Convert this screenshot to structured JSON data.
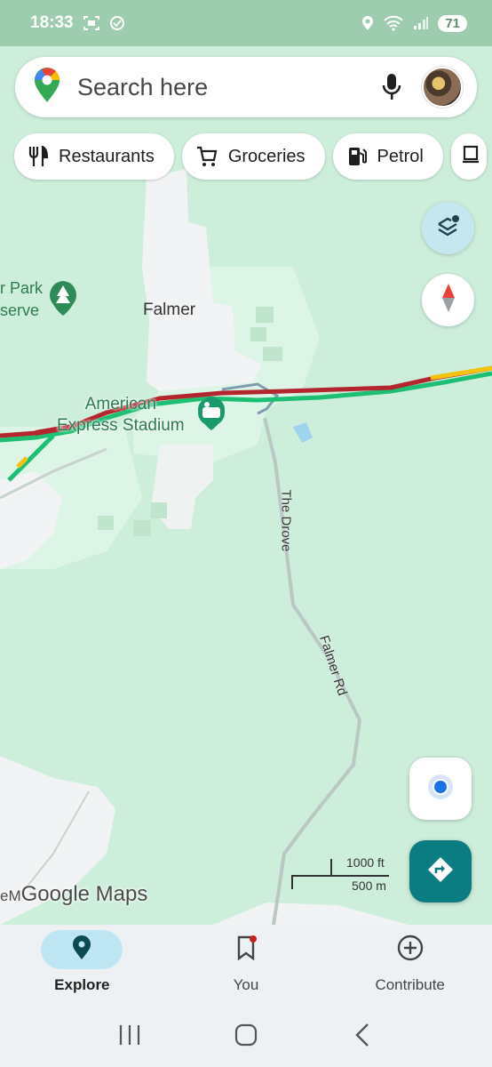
{
  "status_bar": {
    "time": "18:33",
    "battery": "71"
  },
  "search": {
    "placeholder": "Search here"
  },
  "chips": [
    {
      "label": "Restaurants",
      "icon": "restaurant-icon"
    },
    {
      "label": "Groceries",
      "icon": "cart-icon"
    },
    {
      "label": "Petrol",
      "icon": "fuel-icon"
    }
  ],
  "map": {
    "labels": {
      "falmer": "Falmer",
      "park_line1": "r Park",
      "park_line2": "serve",
      "stadium_line1": "American",
      "stadium_line2": "Express Stadium",
      "the_drove": "The Drove",
      "falmer_rd": "Falmer Rd"
    },
    "scale": {
      "imperial": "1000 ft",
      "metric": "500 m"
    },
    "attribution": {
      "prefix": "eM",
      "brand": "Google Maps"
    }
  },
  "bottom_nav": [
    {
      "label": "Explore",
      "icon": "location-pin-icon",
      "active": true
    },
    {
      "label": "You",
      "icon": "bookmark-icon",
      "active": false
    },
    {
      "label": "Contribute",
      "icon": "plus-circle-icon",
      "active": false
    }
  ],
  "colors": {
    "map_bg": "#cdeedb",
    "accent_teal": "#0b7c82",
    "traffic_red": "#b3262d",
    "traffic_green": "#1dbf73"
  }
}
